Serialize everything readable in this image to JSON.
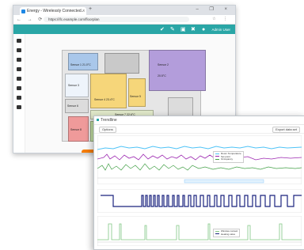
{
  "browser": {
    "tab_title": "Energy - Wirelessly Connected...",
    "tab_close": "×",
    "new_tab": "+",
    "window_controls": "– ❐ ×",
    "nav_buttons": "← → ⟳",
    "url": "https://ifc.example.com/floorplan",
    "addr_icons": "☆ ⋮"
  },
  "app_header": {
    "user_label": "Admin User"
  },
  "floorplan": {
    "rooms": [
      {
        "name": "Sensor 1",
        "value": "21.0°C"
      },
      {
        "name": "Sensor 2",
        "value": "20.5°C"
      },
      {
        "name": "Sensor 3",
        "value": "22.1°C"
      },
      {
        "name": "Sensor 4",
        "value": "23.4°C"
      },
      {
        "name": "Sensor 5",
        "value": "24.0°C"
      },
      {
        "name": "Sensor 6",
        "value": "21.8°C"
      },
      {
        "name": "Sensor 7",
        "value": "22.6°C"
      },
      {
        "name": "Sensor 8",
        "value": "20.9°C"
      }
    ]
  },
  "trend": {
    "title": "Trendline",
    "btn_left": "Options",
    "btn_right": "Export data set",
    "legend_top": [
      "Room Temperature",
      "Set point",
      "Occupancy"
    ],
    "legend_bottom": [
      "Window contact",
      "Heating valve"
    ]
  },
  "colors": {
    "teal": "#2aa6a6",
    "orange": "#f57c00",
    "room_blue": "#a9c7ea",
    "room_yellow": "#f6d67a",
    "room_purple": "#b39ddb",
    "room_red": "#ef9a9a",
    "room_green": "#c5e1a5",
    "room_gray": "#d7d7d7"
  }
}
